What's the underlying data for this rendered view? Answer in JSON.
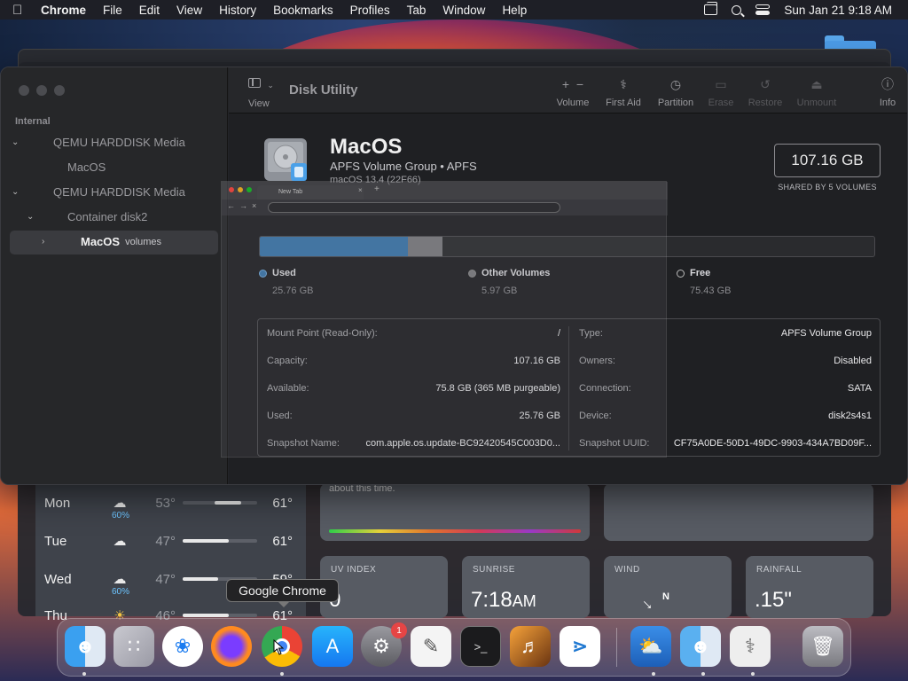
{
  "menubar": {
    "app": "Chrome",
    "items": [
      "File",
      "Edit",
      "View",
      "History",
      "Bookmarks",
      "Profiles",
      "Tab",
      "Window",
      "Help"
    ],
    "clock": "Sun Jan 21  9:18 AM"
  },
  "sidebar": {
    "section": "Internal",
    "items": [
      {
        "label": "QEMU HARDDISK Media"
      },
      {
        "label": "MacOS"
      },
      {
        "label": "QEMU HARDDISK Media"
      },
      {
        "label": "Container disk2"
      },
      {
        "label": "MacOS",
        "suffix": "volumes"
      }
    ]
  },
  "toolbar": {
    "title": "Disk Utility",
    "view_label": "View",
    "tools": [
      {
        "label": "Volume",
        "icon": "plus-minus-icon"
      },
      {
        "label": "First Aid",
        "icon": "stethoscope-icon"
      },
      {
        "label": "Partition",
        "icon": "pie-icon"
      },
      {
        "label": "Erase",
        "icon": "erase-icon"
      },
      {
        "label": "Restore",
        "icon": "restore-icon"
      },
      {
        "label": "Unmount",
        "icon": "eject-icon"
      },
      {
        "label": "Info",
        "icon": "info-icon"
      }
    ]
  },
  "volume": {
    "name": "MacOS",
    "subtitle": "APFS Volume Group • APFS",
    "os": "macOS 13.4 (22F66)",
    "capacity": "107.16 GB",
    "capacity_note": "SHARED BY 5 VOLUMES",
    "usage": {
      "used_fraction": 0.24,
      "other_fraction": 0.056
    },
    "legend": [
      {
        "label": "Used",
        "value": "25.76 GB",
        "color": "#3a75aa"
      },
      {
        "label": "Other Volumes",
        "value": "5.97 GB",
        "color": "#7a7a7e"
      },
      {
        "label": "Free",
        "value": "75.43 GB",
        "color": "#2a2b2e"
      }
    ],
    "info_left": [
      {
        "k": "Mount Point (Read-Only):",
        "v": "/"
      },
      {
        "k": "Capacity:",
        "v": "107.16 GB"
      },
      {
        "k": "Available:",
        "v": "75.8 GB (365 MB purgeable)"
      },
      {
        "k": "Used:",
        "v": "25.76 GB"
      },
      {
        "k": "Snapshot Name:",
        "v": "com.apple.os.update-BC92420545C003D0..."
      }
    ],
    "info_right": [
      {
        "k": "Type:",
        "v": "APFS Volume Group"
      },
      {
        "k": "Owners:",
        "v": "Disabled"
      },
      {
        "k": "Connection:",
        "v": "SATA"
      },
      {
        "k": "Device:",
        "v": "disk2s4s1"
      },
      {
        "k": "Snapshot UUID:",
        "v": "CF75A0DE-50D1-49DC-9903-434A7BD09F..."
      }
    ]
  },
  "ghost_chrome": {
    "tab": "New Tab"
  },
  "weather": {
    "rows": [
      {
        "day": "Mon",
        "pct": "60%",
        "lo": "53°",
        "hi": "61°"
      },
      {
        "day": "Tue",
        "pct": "",
        "lo": "47°",
        "hi": "61°"
      },
      {
        "day": "Wed",
        "pct": "60%",
        "lo": "47°",
        "hi": "59°"
      },
      {
        "day": "Thu",
        "pct": "",
        "lo": "46°",
        "hi": "61°"
      }
    ],
    "note": "about this time.",
    "uv_label": "UV INDEX",
    "uv_value": "0",
    "sunrise_label": "SUNRISE",
    "sunrise_value": "7:18",
    "sunrise_ampm": "AM",
    "wind_label": "WIND",
    "rain_label": "RAINFALL",
    "rain_value": ".15\""
  },
  "dock": {
    "tooltip": "Google Chrome",
    "settings_badge": "1"
  }
}
